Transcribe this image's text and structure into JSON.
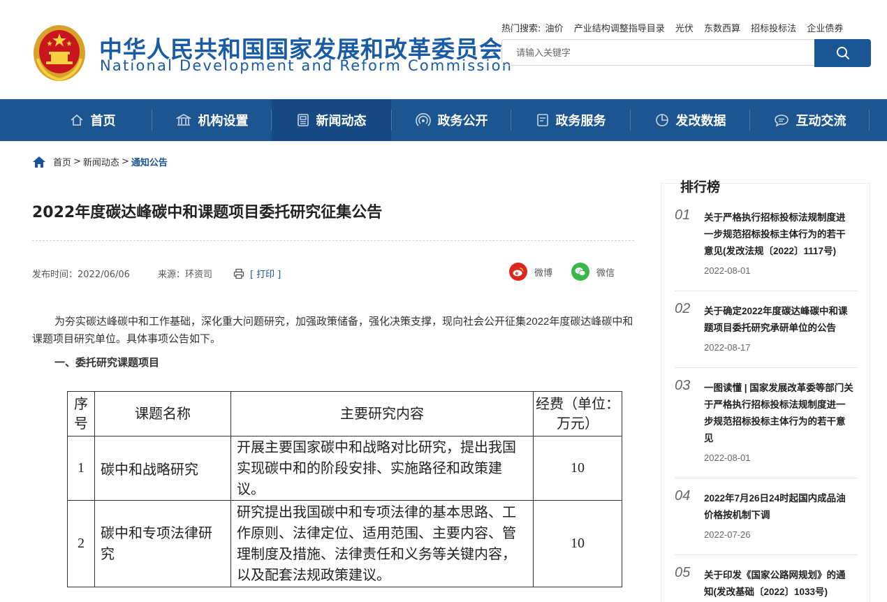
{
  "header": {
    "site_name_cn": "中华人民共和国国家发展和改革委员会",
    "site_name_en": "National Development and Reform Commission",
    "hot_label": "热门搜索:",
    "hot_searches": [
      "油价",
      "产业结构调整指导目录",
      "光伏",
      "东数西算",
      "招标投标法",
      "企业债券"
    ],
    "search_placeholder": "请输入关键字",
    "brand_color": "#1d5590"
  },
  "nav": {
    "items": [
      {
        "label": "首页",
        "icon": "home-icon"
      },
      {
        "label": "机构设置",
        "icon": "building-icon"
      },
      {
        "label": "新闻动态",
        "icon": "news-icon",
        "active": true
      },
      {
        "label": "政务公开",
        "icon": "broadcast-icon"
      },
      {
        "label": "政务服务",
        "icon": "document-icon"
      },
      {
        "label": "发改数据",
        "icon": "pie-chart-icon"
      },
      {
        "label": "互动交流",
        "icon": "chat-icon"
      }
    ]
  },
  "breadcrumb": {
    "home": "首页",
    "sep": ">",
    "level1": "新闻动态",
    "current": "通知公告"
  },
  "article": {
    "title": "2022年度碳达峰碳中和课题项目委托研究征集公告",
    "publish_label": "发布时间：2022/06/06",
    "source_label": "来源：环资司",
    "print_label": "[ 打印 ]",
    "share_weibo": "微博",
    "share_wechat": "微信",
    "intro": "为夯实碳达峰碳中和工作基础，深化重大问题研究，加强政策储备，强化决策支撑，现向社会公开征集2022年度碳达峰碳中和课题项目研究单位。具体事项公告如下。",
    "section1": "一、委托研究课题项目",
    "table": {
      "headers": [
        "序号",
        "课题名称",
        "主要研究内容",
        "经费（单位：万元）"
      ],
      "rows": [
        {
          "no": "1",
          "name": "碳中和战略研究",
          "content": "开展主要国家碳中和战略对比研究，提出我国实现碳中和的阶段安排、实施路径和政策建议。",
          "fee": "10"
        },
        {
          "no": "2",
          "name": "碳中和专项法律研究",
          "content": "研究提出我国碳中和专项法律的基本思路、工作原则、法律定位、适用范围、主要内容、管理制度及措施、法律责任和义务等关键内容，以及配套法规政策建议。",
          "fee": "10"
        }
      ]
    }
  },
  "sidebar": {
    "title": "排行榜",
    "items": [
      {
        "num": "01",
        "title": "关于严格执行招标投标法规制度进一步规范招标投标主体行为的若干意见(发改法规〔2022〕1117号)",
        "date": "2022-08-01"
      },
      {
        "num": "02",
        "title": "关于确定2022年度碳达峰碳中和课题项目委托研究承研单位的公告",
        "date": "2022-08-17"
      },
      {
        "num": "03",
        "title": "一图读懂 | 国家发展改革委等部门关于严格执行招标投标法规制度进一步规范招标投标主体行为的若干意见",
        "date": "2022-08-01"
      },
      {
        "num": "04",
        "title": "2022年7月26日24时起国内成品油价格按机制下调",
        "date": "2022-07-26"
      },
      {
        "num": "05",
        "title": "关于印发《国家公路网规划》的通知(发改基础〔2022〕1033号)",
        "date": ""
      }
    ]
  }
}
